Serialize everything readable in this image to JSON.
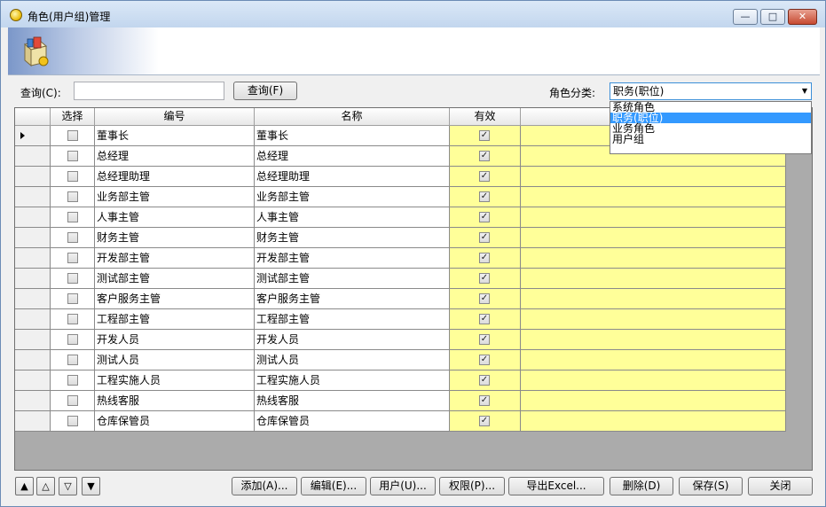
{
  "window": {
    "title": "角色(用户组)管理",
    "minimize_glyph": "—",
    "maximize_glyph": "□",
    "close_glyph": "✕"
  },
  "query": {
    "label": "查询(C):",
    "value": "",
    "button_label": "查询(F)"
  },
  "category": {
    "label": "角色分类:",
    "selected": "职务(职位)",
    "options": [
      "系统角色",
      "职务(职位)",
      "业务角色",
      "用户组"
    ],
    "selected_index": 1
  },
  "grid": {
    "columns": [
      "",
      "选择",
      "编号",
      "名称",
      "有效",
      ""
    ],
    "current_row_index": 0,
    "rows": [
      {
        "selected": false,
        "code": "董事长",
        "name": "董事长",
        "valid": true
      },
      {
        "selected": false,
        "code": "总经理",
        "name": "总经理",
        "valid": true
      },
      {
        "selected": false,
        "code": "总经理助理",
        "name": "总经理助理",
        "valid": true
      },
      {
        "selected": false,
        "code": "业务部主管",
        "name": "业务部主管",
        "valid": true
      },
      {
        "selected": false,
        "code": "人事主管",
        "name": "人事主管",
        "valid": true
      },
      {
        "selected": false,
        "code": "财务主管",
        "name": "财务主管",
        "valid": true
      },
      {
        "selected": false,
        "code": "开发部主管",
        "name": "开发部主管",
        "valid": true
      },
      {
        "selected": false,
        "code": "测试部主管",
        "name": "测试部主管",
        "valid": true
      },
      {
        "selected": false,
        "code": "客户服务主管",
        "name": "客户服务主管",
        "valid": true
      },
      {
        "selected": false,
        "code": "工程部主管",
        "name": "工程部主管",
        "valid": true
      },
      {
        "selected": false,
        "code": "开发人员",
        "name": "开发人员",
        "valid": true
      },
      {
        "selected": false,
        "code": "测试人员",
        "name": "测试人员",
        "valid": true
      },
      {
        "selected": false,
        "code": "工程实施人员",
        "name": "工程实施人员",
        "valid": true
      },
      {
        "selected": false,
        "code": "热线客服",
        "name": "热线客服",
        "valid": true
      },
      {
        "selected": false,
        "code": "仓库保管员",
        "name": "仓库保管员",
        "valid": true
      }
    ],
    "check_glyph": "✓"
  },
  "nav_buttons": [
    {
      "name": "move-first-button",
      "glyph": "▲"
    },
    {
      "name": "move-up-button",
      "glyph": "△"
    },
    {
      "name": "move-down-button",
      "glyph": "▽"
    },
    {
      "name": "move-last-button",
      "glyph": "▼"
    }
  ],
  "actions": [
    {
      "name": "add-button",
      "label": "添加(A)..."
    },
    {
      "name": "edit-button",
      "label": "编辑(E)..."
    },
    {
      "name": "users-button",
      "label": "用户(U)..."
    },
    {
      "name": "permissions-button",
      "label": "权限(P)..."
    },
    {
      "name": "export-excel-button",
      "label": "导出Excel..."
    },
    {
      "name": "delete-button",
      "label": "删除(D)"
    },
    {
      "name": "save-button",
      "label": "保存(S)"
    },
    {
      "name": "close-button",
      "label": "关闭"
    }
  ],
  "icons": {
    "window": "app-sun-icon",
    "banner": "package-box-icon",
    "row_pointer": "current-row-triangle-icon",
    "dropdown": "chevron-down-icon"
  }
}
